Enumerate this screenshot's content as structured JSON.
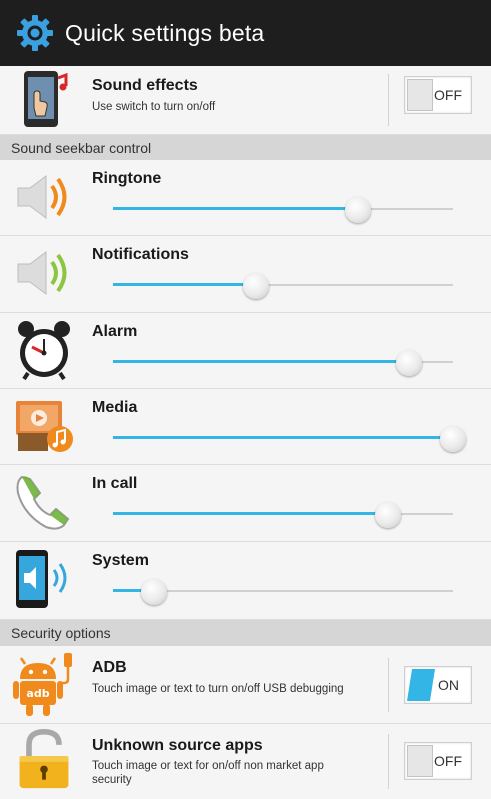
{
  "actionbar": {
    "title": "Quick settings beta",
    "icon": "gear-icon"
  },
  "sound_effects": {
    "label": "Sound effects",
    "sub": "Use switch to turn on/off",
    "toggle": "OFF",
    "icon": "touch-sound-icon"
  },
  "sections": {
    "sound": "Sound seekbar control",
    "security": "Security options"
  },
  "sliders": [
    {
      "label": "Ringtone",
      "icon": "speaker-orange-icon",
      "level": 0.72
    },
    {
      "label": "Notifications",
      "icon": "speaker-green-icon",
      "level": 0.42
    },
    {
      "label": "Alarm",
      "icon": "alarm-clock-icon",
      "level": 0.87
    },
    {
      "label": "Media",
      "icon": "media-icon",
      "level": 1.0
    },
    {
      "label": "In call",
      "icon": "phone-icon",
      "level": 0.81
    },
    {
      "label": "System",
      "icon": "phone-speaker-icon",
      "level": 0.12
    }
  ],
  "adb": {
    "label": "ADB",
    "sub": "Touch image or text to turn on/off USB debugging",
    "toggle": "ON",
    "icon": "android-usb-icon"
  },
  "unknown_sources": {
    "label": "Unknown source apps",
    "sub": "Touch image or text for on/off non market app security",
    "toggle": "OFF",
    "icon": "padlock-icon"
  },
  "colors": {
    "accent": "#33b5e5",
    "actionbar": "#1e1e1e",
    "section": "#d6d6d6"
  }
}
